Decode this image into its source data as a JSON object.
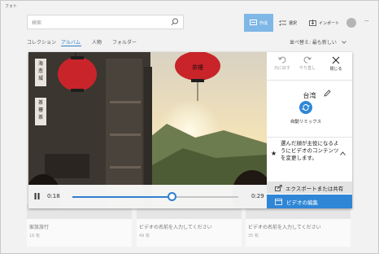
{
  "window": {
    "title": "フォト"
  },
  "search": {
    "placeholder": "検索"
  },
  "toolbar": {
    "create_label": "作成",
    "select_label": "選択",
    "import_label": "インポート",
    "more_label": "···"
  },
  "nav": {
    "items": [
      {
        "label": "コレクション",
        "active": false
      },
      {
        "label": "アルバム",
        "active": true
      },
      {
        "label": "人物",
        "active": false
      },
      {
        "label": "フォルダー",
        "active": false
      }
    ],
    "sort_label": "並べ替え: 最も新しい",
    "sort_icon": "chevron-down-icon"
  },
  "albums": [
    {
      "name": "家族旅行",
      "count": "16 枚"
    },
    {
      "name": "ビデオの名前を入力してください",
      "count": "49 枚"
    },
    {
      "name": "ビデオの名前を入力してください",
      "count": "35 枚"
    }
  ],
  "player": {
    "current_time": "0:18",
    "end_time": "0:29",
    "progress": 0.6,
    "accent_color": "#2f7fcf"
  },
  "panel": {
    "undo_label": "元に戻す",
    "redo_label": "やり直し",
    "close_label": "閉じる",
    "title": "台湾",
    "remix_label": "自動リミックス",
    "description": "選んだ顔が主役になるようにビデオのコンテンツを変更します。",
    "export_label": "エクスポートまたは共有",
    "edit_label": "ビデオの編集",
    "edit_color": "#2f86d6"
  }
}
